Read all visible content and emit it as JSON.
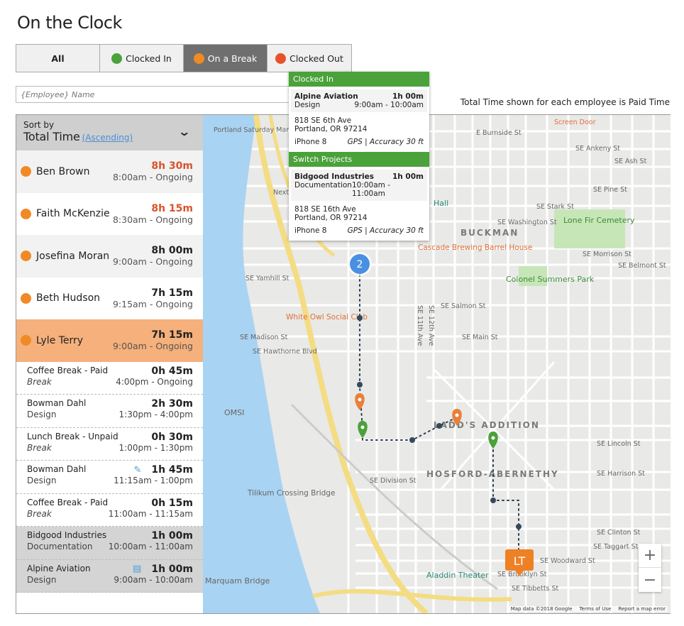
{
  "page_title": "On the Clock",
  "filters": [
    {
      "label": "All",
      "active": false
    },
    {
      "label": "Clocked In",
      "color": "#4aa23a",
      "active": false
    },
    {
      "label": "On a Break",
      "color": "#f08a24",
      "active": true
    },
    {
      "label": "Clocked Out",
      "color": "#e8522a",
      "active": false
    }
  ],
  "search": {
    "placeholder": "{Employee} Name"
  },
  "note": "Total Time shown for each employee is Paid Time",
  "sort": {
    "label": "Sort by",
    "value": "Total Time",
    "order": "(Ascending)"
  },
  "employees": [
    {
      "name": "Ben Brown",
      "total": "8h 30m",
      "span": "8:00am - Ongoing",
      "overtime": true
    },
    {
      "name": "Faith McKenzie",
      "total": "8h 15m",
      "span": "8:30am - Ongoing",
      "overtime": true
    },
    {
      "name": "Josefina Moran",
      "total": "8h 00m",
      "span": "9:00am - Ongoing"
    },
    {
      "name": "Beth Hudson",
      "total": "7h 15m",
      "span": "9:15am - Ongoing"
    },
    {
      "name": "Lyle Terry",
      "total": "7h 15m",
      "span": "9:00am - Ongoing",
      "selected": true
    }
  ],
  "entries": [
    {
      "title": "Coffee Break - Paid",
      "sub": "Break",
      "total": "0h 45m",
      "span": "4:00pm - Ongoing"
    },
    {
      "title": "Bowman Dahl",
      "sub": "Design",
      "total": "2h 30m",
      "span": "1:30pm - 4:00pm"
    },
    {
      "title": "Lunch Break - Unpaid",
      "sub": "Break",
      "total": "0h 30m",
      "span": "1:00pm - 1:30pm"
    },
    {
      "title": "Bowman Dahl",
      "sub": "Design",
      "total": "1h 45m",
      "span": "11:15am - 1:00pm",
      "icon": "edit-icon"
    },
    {
      "title": "Coffee Break - Paid",
      "sub": "Break",
      "total": "0h 15m",
      "span": "11:00am - 11:15am"
    },
    {
      "title": "Bidgood Industries",
      "sub": "Documentation",
      "total": "1h 00m",
      "span": "10:00am - 11:00am"
    },
    {
      "title": "Alpine Aviation",
      "sub": "Design",
      "total": "1h 00m",
      "span": "9:00am - 10:00am",
      "icon": "note-icon"
    }
  ],
  "popup": {
    "sections": [
      {
        "header": "Clocked In",
        "client": "Alpine Aviation",
        "total": "1h 00m",
        "task": "Design",
        "span": "9:00am - 10:00am",
        "addr1": "818 SE 6th Ave",
        "addr2": "Portland, OR 97214",
        "device": "iPhone 8",
        "gps": "GPS | Accuracy 30 ft"
      },
      {
        "header": "Switch Projects",
        "client": "Bidgood Industries",
        "total": "1h 00m",
        "task": "Documentation",
        "span": "10:00am - 11:00am",
        "addr1": "818 SE 16th Ave",
        "addr2": "Portland, OR 97214",
        "device": "iPhone 8",
        "gps": "GPS | Accuracy 30 ft"
      }
    ]
  },
  "map": {
    "cluster_count": "2",
    "employee_marker": "LT",
    "labels": [
      "Portland Saturday Market",
      "E Burnside St",
      "Screen Door",
      "SE Ankeny St",
      "SE Ash St",
      "SE Pine St",
      "SE Stark St",
      "SE Washington St",
      "Lone Fir Cemetery",
      "BUCKMAN",
      "SE Morrison St",
      "SE Belmont St",
      "Cascade Brewing Barrel House",
      "SE Yamhill St",
      "Colonel Summers Park",
      "White Owl Social Club",
      "SE Salmon St",
      "SE Madison St",
      "SE Main St",
      "SE Hawthorne Blvd",
      "OMSI",
      "LADD'S ADDITION",
      "HOSFORD-ABERNETHY",
      "SE Division St",
      "Tilikum Crossing Bridge",
      "SE Lincoln St",
      "SE Harrison St",
      "SE Clinton St",
      "SE Taggart St",
      "SE Woodward St",
      "SE Brooklyn St",
      "SE Tibbetts St",
      "Aladdin Theater",
      "SE 11th Ave",
      "SE 12th Ave",
      "Hall",
      "Next",
      "Marquam Bridge"
    ],
    "zoom_in": "+",
    "zoom_out": "−",
    "attribution": [
      "Map data ©2018 Google",
      "Terms of Use",
      "Report a map error"
    ]
  },
  "colors": {
    "clocked_in": "#4aa23a",
    "on_break": "#f08a24",
    "clocked_out": "#e8522a",
    "overtime": "#d9532b",
    "selected_row": "#f5b07b",
    "marker_blue": "#4a90e2"
  }
}
